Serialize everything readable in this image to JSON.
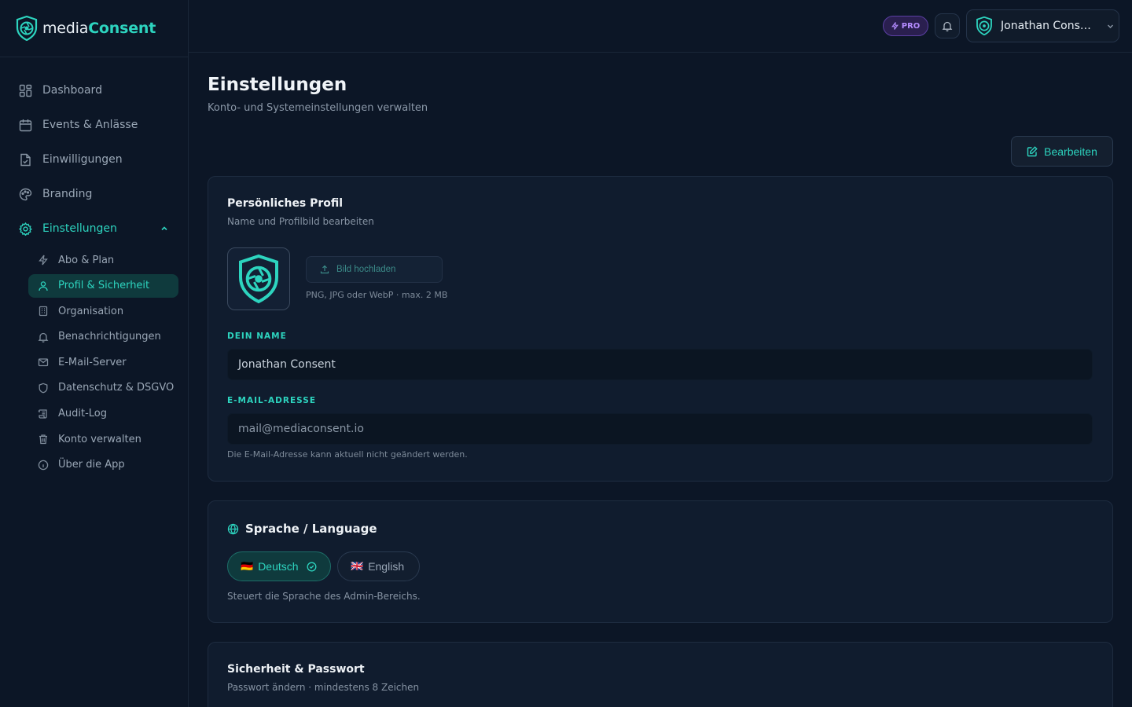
{
  "app": {
    "logo_part1": "media",
    "logo_part2": "Consent"
  },
  "sidebar": {
    "items": [
      {
        "label": "Dashboard",
        "icon": "dashboard-icon"
      },
      {
        "label": "Events & Anlässe",
        "icon": "calendar-icon"
      },
      {
        "label": "Einwilligungen",
        "icon": "file-check-icon"
      },
      {
        "label": "Branding",
        "icon": "palette-icon"
      },
      {
        "label": "Einstellungen",
        "icon": "gear-icon",
        "active": true,
        "expanded": true
      }
    ],
    "subitems": [
      {
        "label": "Abo & Plan",
        "icon": "zap-icon"
      },
      {
        "label": "Profil & Sicherheit",
        "icon": "user-icon",
        "active": true
      },
      {
        "label": "Organisation",
        "icon": "building-icon"
      },
      {
        "label": "Benachrichtigungen",
        "icon": "bell-icon"
      },
      {
        "label": "E-Mail-Server",
        "icon": "mail-icon"
      },
      {
        "label": "Datenschutz & DSGVO",
        "icon": "shield-icon"
      },
      {
        "label": "Audit-Log",
        "icon": "scroll-icon"
      },
      {
        "label": "Konto verwalten",
        "icon": "trash-icon"
      },
      {
        "label": "Über die App",
        "icon": "info-icon"
      }
    ]
  },
  "topbar": {
    "badge": "PRO",
    "user_name": "Jonathan Consent"
  },
  "page": {
    "title": "Einstellungen",
    "subtitle": "Konto- und Systemeinstellungen verwalten",
    "edit_label": "Bearbeiten"
  },
  "profile": {
    "title": "Persönliches Profil",
    "subtitle": "Name und Profilbild bearbeiten",
    "upload_label": "Bild hochladen",
    "upload_hint": "PNG, JPG oder WebP · max. 2 MB",
    "name_label": "DEIN NAME",
    "name_value": "Jonathan Consent",
    "email_label": "E-MAIL-ADRESSE",
    "email_value": "mail@mediaconsent.io",
    "email_hint": "Die E-Mail-Adresse kann aktuell nicht geändert werden."
  },
  "language": {
    "title": "Sprache / Language",
    "options": [
      {
        "flag": "🇩🇪",
        "label": "Deutsch",
        "selected": true
      },
      {
        "flag": "🇬🇧",
        "label": "English",
        "selected": false
      }
    ],
    "hint": "Steuert die Sprache des Admin-Bereichs."
  },
  "security": {
    "title": "Sicherheit & Passwort",
    "subtitle": "Passwort ändern · mindestens 8 Zeichen"
  },
  "colors": {
    "accent": "#2dd4bf",
    "background": "#0c1626",
    "card": "#101c2e",
    "pro": "#b48cff"
  }
}
